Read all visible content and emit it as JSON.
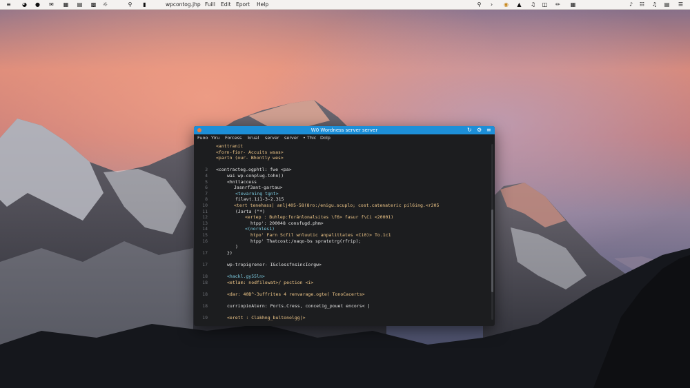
{
  "menubar": {
    "icons_left": [
      "menu-icon",
      "clock-icon",
      "clip-icon",
      "mail-icon",
      "grid-icon",
      "bars-icon",
      "apps-icon",
      "sun-icon",
      "folder-icon"
    ],
    "app_name": "wpcontog.jhp",
    "menus": [
      "Fuill",
      "Edit",
      "Eport",
      "Help"
    ],
    "icons_right": [
      "search-icon",
      "chevron-icon",
      "coin-icon",
      "wifi-icon",
      "volume-icon",
      "battery-icon",
      "brush-icon",
      "note-icon",
      "doc-icon",
      "music-icon"
    ],
    "accent": "#f4f2f0"
  },
  "terminal": {
    "title": "W0 Wordness server server",
    "titlebar_color": "#1d8fd8",
    "menu": [
      "Fuoo",
      "Yiru",
      "Forcess",
      "krual",
      "server",
      "server",
      "• Thic",
      "Dolp"
    ],
    "lines": [
      {
        "n": "",
        "t": "<anttranit",
        "c": "#f2c98a"
      },
      {
        "n": "",
        "t": "<forn-fior- Accuits wsas>",
        "c": "#f2c98a"
      },
      {
        "n": "",
        "t": "<partn (our- Bhontly wes>",
        "c": "#f2c98a"
      },
      {
        "n": "",
        "t": "",
        "c": "#e6e6e6"
      },
      {
        "n": "3",
        "t": "<contracteg.ogphtl: fwe <pa>",
        "c": "#e6e6e6"
      },
      {
        "n": "4",
        "t": "wai wp-conplug.tohn))",
        "c": "#e6e6e6"
      },
      {
        "n": "5",
        "t": "<hnttaccess",
        "c": "#e6e6e6"
      },
      {
        "n": "6",
        "t": "Jasnrf3ant-gartau>",
        "c": "#e6e6e6"
      },
      {
        "n": "7",
        "t": "<tevarning tgnt>",
        "c": "#7fd0e6"
      },
      {
        "n": "8",
        "t": "filavt.1i1-3-2.315",
        "c": "#e6e6e6"
      },
      {
        "n": "10",
        "t": "<tert tenehass| anlj405-58(8ro:/enigu.scuplo; cost.catenateric pil6ing.<r205",
        "c": "#f2c98a"
      },
      {
        "n": "11",
        "t": "(Jartа (\"*)",
        "c": "#e6e6e6"
      },
      {
        "n": "12",
        "t": "<ertep  : Buhlep:forānlonalsites  \\f6> fasur f\\Ci  <20001)",
        "c": "#f2c98a"
      },
      {
        "n": "13",
        "t": "htpp': 200048 consfugd.phm>",
        "c": "#e6e6e6"
      },
      {
        "n": "14",
        "t": "<(nornles1)",
        "c": "#7fd0e6"
      },
      {
        "n": "15",
        "t": "htpo' Farn Scfil wnluutic anpalittates <Ci0)> To.1c1",
        "c": "#f2c98a"
      },
      {
        "n": "16",
        "t": "htpp' Thatcost:/naqo-bs spratotrg(rfrip);",
        "c": "#e6e6e6"
      },
      {
        "n": "",
        "t": ")",
        "c": "#e6e6e6"
      },
      {
        "n": "17",
        "t": "})",
        "c": "#e6e6e6"
      },
      {
        "n": "",
        "t": "",
        "c": "#e6e6e6"
      },
      {
        "n": "17",
        "t": "wp-tropigrenor- I&clessfnsincIorgw>",
        "c": "#e6e6e6"
      },
      {
        "n": "",
        "t": "",
        "c": "#e6e6e6"
      },
      {
        "n": "18",
        "t": "<hackl.gy55ln>",
        "c": "#7fd0e6"
      },
      {
        "n": "18",
        "t": "<etlam: nodfilowat>/ pection <i>",
        "c": "#f2c98a"
      },
      {
        "n": "",
        "t": "",
        "c": "#e6e6e6"
      },
      {
        "n": "18",
        "t": "<dar: 40B^-3uffrites 4 renvarage.ogte( TonoCacerts>",
        "c": "#f2c98a"
      },
      {
        "n": "",
        "t": "",
        "c": "#e6e6e6"
      },
      {
        "n": "18",
        "t": "curriopioAtern: Ports.Cress, concetig_pouet encors< |",
        "c": "#e6e6e6"
      },
      {
        "n": "",
        "t": "",
        "c": "#e6e6e6"
      },
      {
        "n": "19",
        "t": "<erett : Clakhng_bultonolgg|>",
        "c": "#f2c98a"
      }
    ]
  }
}
